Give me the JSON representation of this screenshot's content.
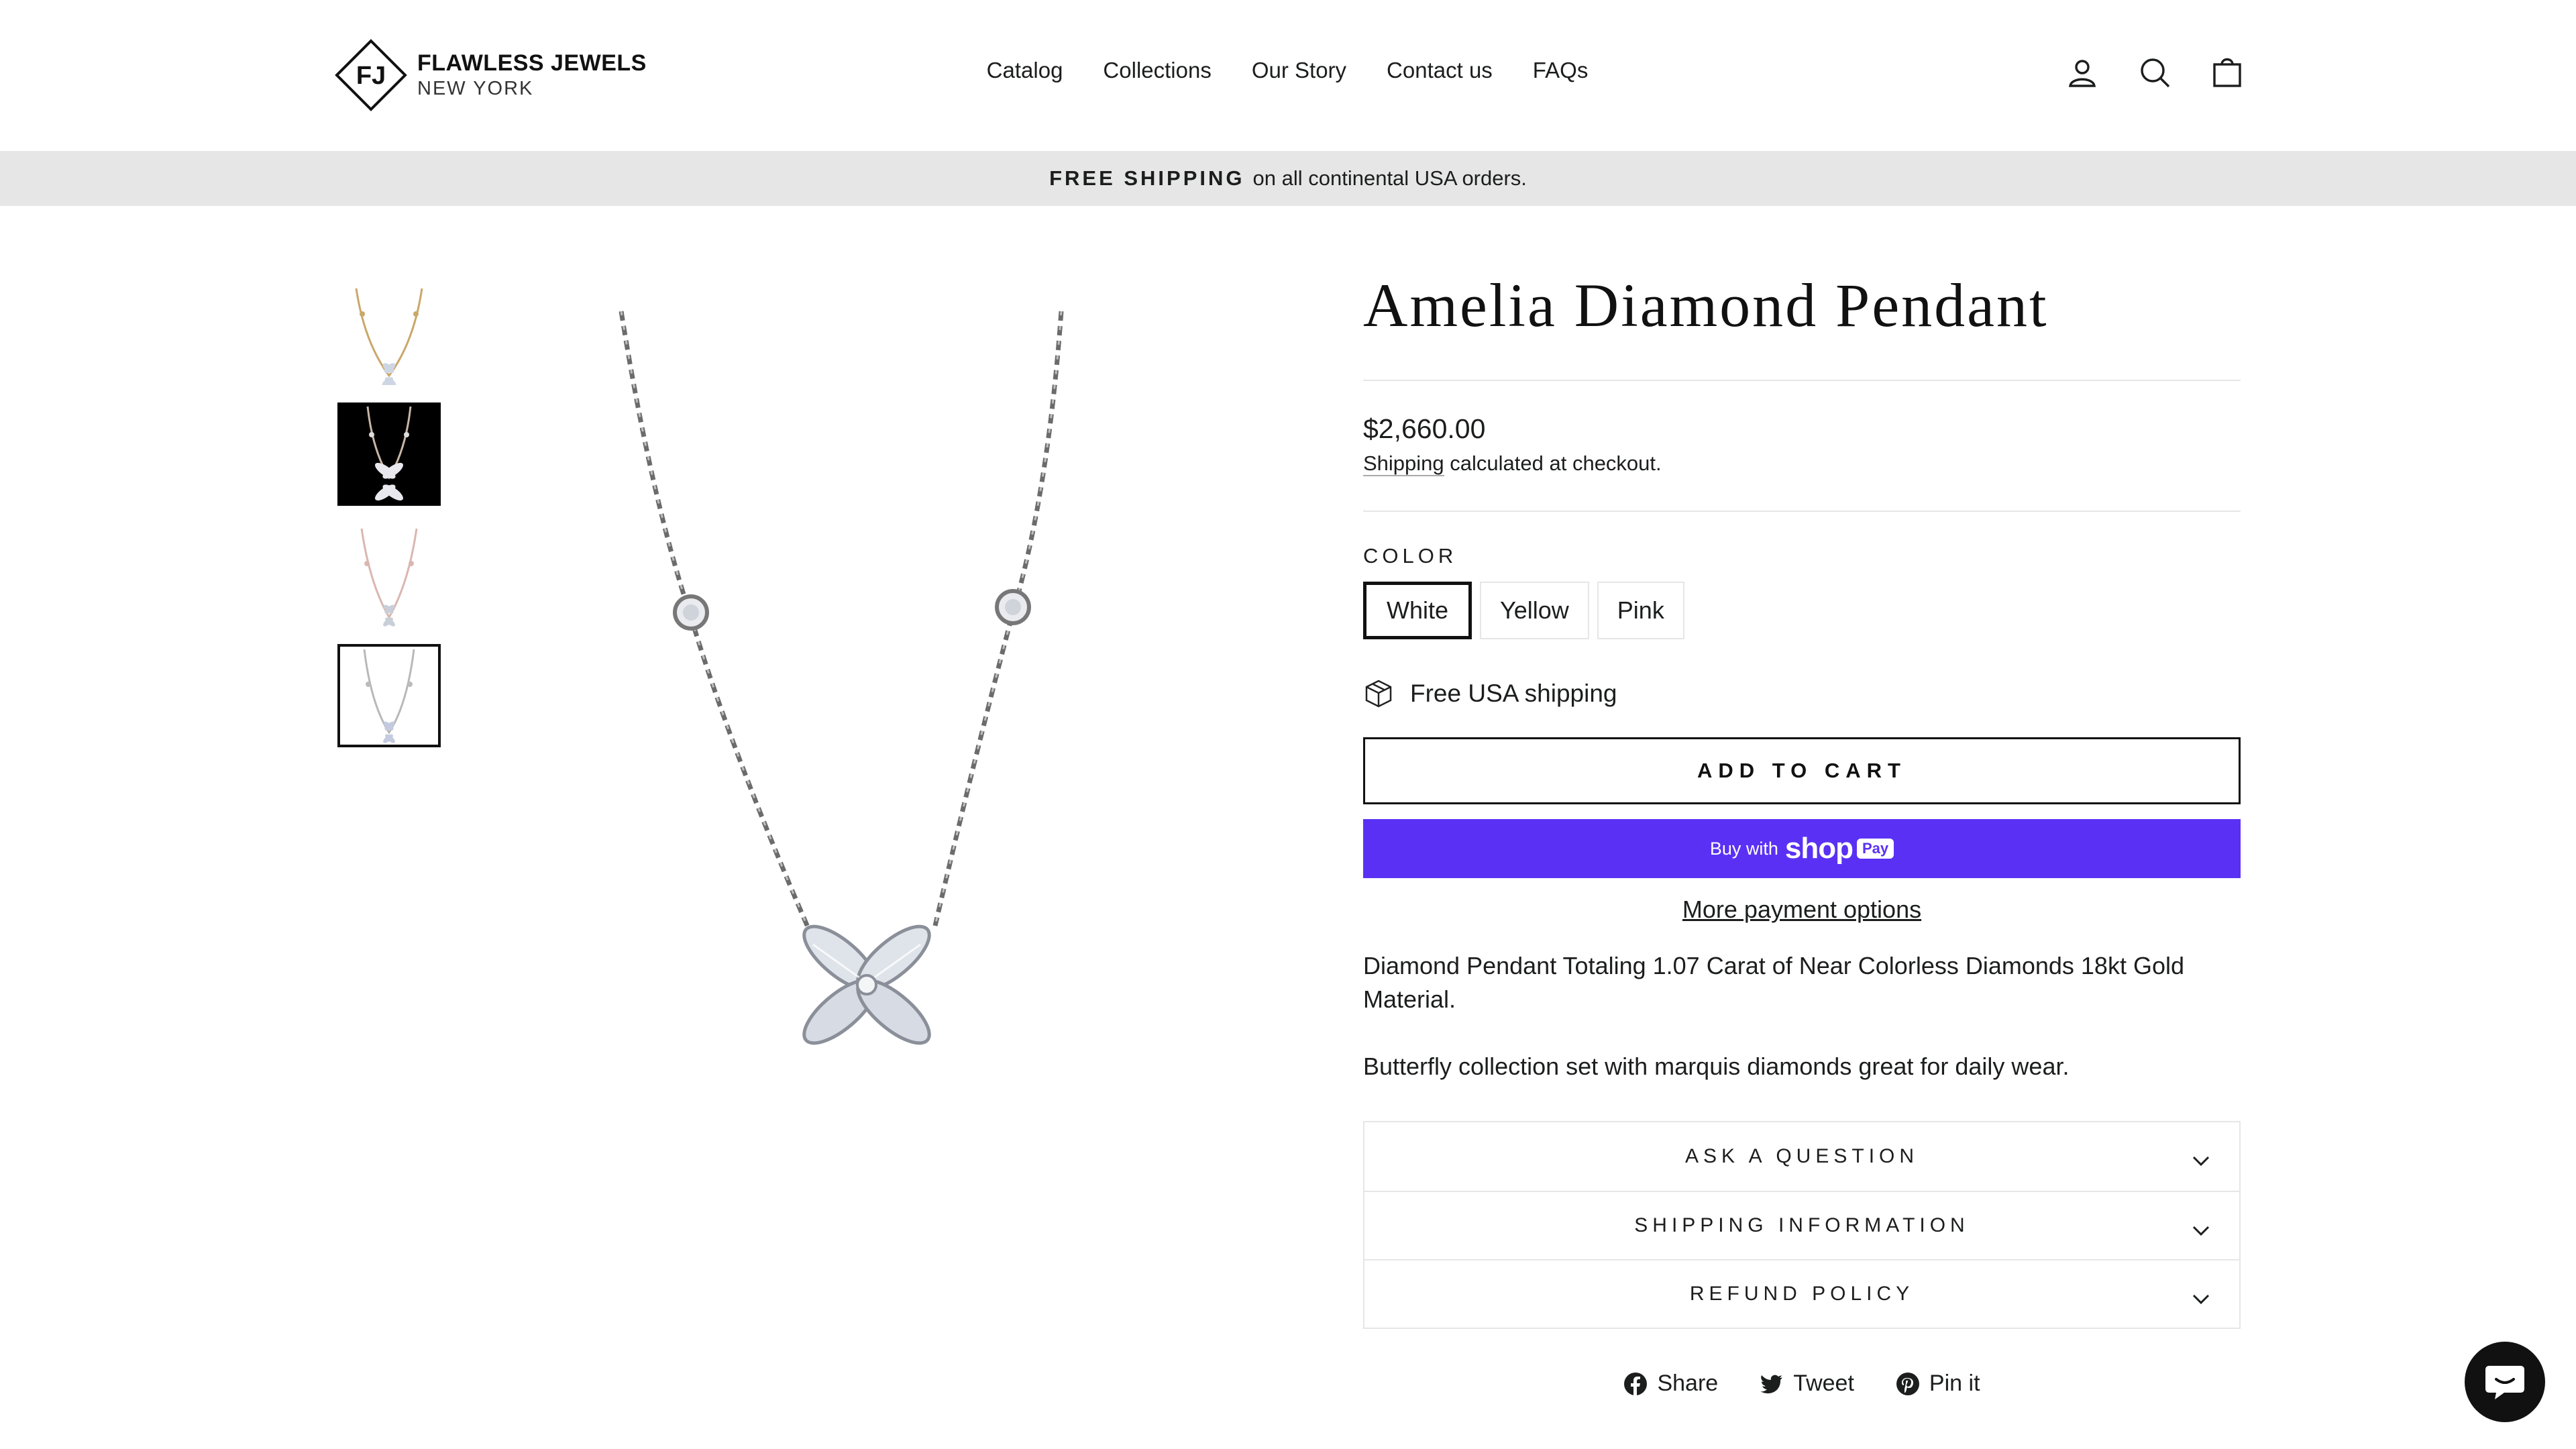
{
  "brand": {
    "name": "FLAWLESS JEWELS",
    "city": "NEW YORK",
    "monogram": "FJ"
  },
  "nav": {
    "items": [
      "Catalog",
      "Collections",
      "Our Story",
      "Contact us",
      "FAQs"
    ]
  },
  "header_icons": [
    "account-icon",
    "search-icon",
    "cart-icon"
  ],
  "announcement": {
    "bold": "FREE SHIPPING",
    "text": "on all continental USA orders."
  },
  "product": {
    "title": "Amelia Diamond Pendant",
    "price": "$2,660.00",
    "shipping_link": "Shipping",
    "shipping_note": "calculated at checkout.",
    "color_label": "COLOR",
    "colors": [
      "White",
      "Yellow",
      "Pink"
    ],
    "selected_color": "White",
    "free_shipping": "Free USA shipping",
    "add_to_cart": "ADD TO CART",
    "shop_pay": {
      "buy_with": "Buy with",
      "shop": "shop",
      "pay": "Pay"
    },
    "more_payment": "More payment options",
    "description": [
      "Diamond Pendant Totaling 1.07 Carat of Near Colorless Diamonds 18kt Gold Material.",
      "Butterfly collection set with marquis diamonds great for daily wear."
    ]
  },
  "accordion": [
    "ASK A QUESTION",
    "SHIPPING INFORMATION",
    "REFUND POLICY"
  ],
  "share": {
    "share": "Share",
    "tweet": "Tweet",
    "pin": "Pin it"
  },
  "colors": {
    "shop_pay": "#5a31f4",
    "announce_bg": "#e6e6e6",
    "text": "#1c1d1d"
  }
}
